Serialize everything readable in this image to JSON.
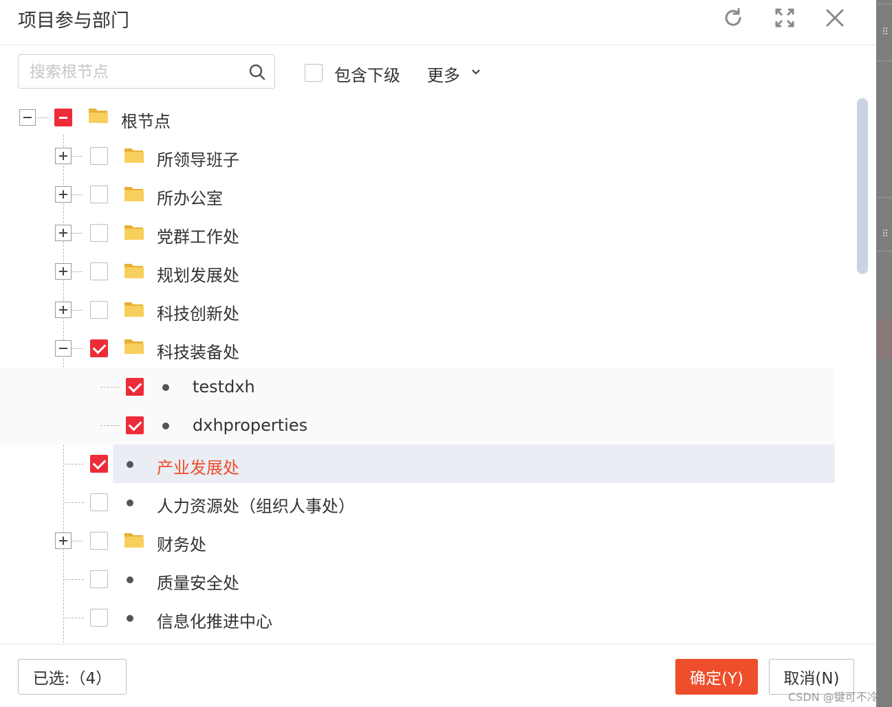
{
  "dialog": {
    "title": "项目参与部门"
  },
  "header_icons": [
    "refresh-icon",
    "fullscreen-icon",
    "close-icon"
  ],
  "toolbar": {
    "search_placeholder": "搜索根节点",
    "include_sub_label": "包含下级",
    "include_sub_checked": false,
    "more_label": "更多"
  },
  "tree": {
    "root": {
      "label": "根节点",
      "state": "partial",
      "expanded": true
    },
    "items": [
      {
        "label": "所领导班子",
        "checked": false,
        "has_children": true
      },
      {
        "label": "所办公室",
        "checked": false,
        "has_children": true
      },
      {
        "label": "党群工作处",
        "checked": false,
        "has_children": true
      },
      {
        "label": "规划发展处",
        "checked": false,
        "has_children": true
      },
      {
        "label": "科技创新处",
        "checked": false,
        "has_children": true
      },
      {
        "label": "科技装备处",
        "checked": true,
        "has_children": true,
        "expanded": true,
        "children": [
          {
            "label": "testdxh",
            "checked": true
          },
          {
            "label": "dxhproperties",
            "checked": true
          }
        ]
      },
      {
        "label": "产业发展处",
        "checked": true,
        "has_children": false,
        "selected": true
      },
      {
        "label": "人力资源处（组织人事处）",
        "checked": false,
        "has_children": false
      },
      {
        "label": "财务处",
        "checked": false,
        "has_children": true
      },
      {
        "label": "质量安全处",
        "checked": false,
        "has_children": false
      },
      {
        "label": "信息化推进中心",
        "checked": false,
        "has_children": false
      }
    ]
  },
  "footer": {
    "selected_label": "已选:（4）",
    "ok_label": "确定(Y)",
    "cancel_label": "取消(N)"
  },
  "colors": {
    "check_red": "#ed2c39",
    "ok_button": "#ee4e2b",
    "selected_text": "#ee4e2b",
    "selected_row": "#eaedf4"
  },
  "watermark": "CSDN @键可不冷"
}
